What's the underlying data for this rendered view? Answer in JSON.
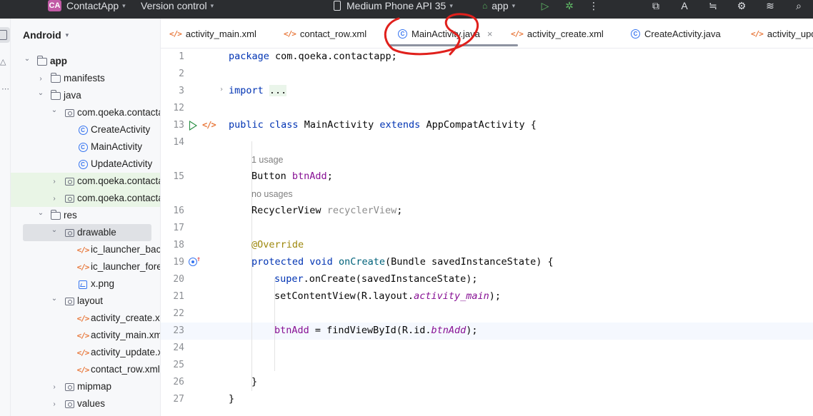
{
  "titlebar": {
    "app_badge": "CA",
    "project_name": "ContactApp",
    "vcs": "Version control",
    "device": "Medium Phone API 35",
    "run_config": "app"
  },
  "project_panel": {
    "header": "Android",
    "tree": [
      {
        "label": "app",
        "indent": 0,
        "icon": "module-folder",
        "arrow": "down",
        "bold": true
      },
      {
        "label": "manifests",
        "indent": 1,
        "icon": "folder",
        "arrow": "right"
      },
      {
        "label": "java",
        "indent": 1,
        "icon": "folder",
        "arrow": "down"
      },
      {
        "label": "com.qoeka.contactapp",
        "indent": 2,
        "icon": "package",
        "arrow": "down"
      },
      {
        "label": "CreateActivity",
        "indent": 3,
        "icon": "class"
      },
      {
        "label": "MainActivity",
        "indent": 3,
        "icon": "class"
      },
      {
        "label": "UpdateActivity",
        "indent": 3,
        "icon": "class"
      },
      {
        "label": "com.qoeka.contactapp (androidTest)",
        "indent": 2,
        "icon": "package",
        "arrow": "right",
        "green": true
      },
      {
        "label": "com.qoeka.contactapp (test)",
        "indent": 2,
        "icon": "package",
        "arrow": "right",
        "green": true
      },
      {
        "label": "res",
        "indent": 1,
        "icon": "folder",
        "arrow": "down"
      },
      {
        "label": "drawable",
        "indent": 2,
        "icon": "package",
        "arrow": "down",
        "selected": true
      },
      {
        "label": "ic_launcher_background.xml",
        "indent": 3,
        "icon": "xml"
      },
      {
        "label": "ic_launcher_foreground.xml",
        "indent": 3,
        "icon": "xml"
      },
      {
        "label": "x.png",
        "indent": 3,
        "icon": "image"
      },
      {
        "label": "layout",
        "indent": 2,
        "icon": "package",
        "arrow": "down"
      },
      {
        "label": "activity_create.xml",
        "indent": 3,
        "icon": "xml"
      },
      {
        "label": "activity_main.xml",
        "indent": 3,
        "icon": "xml"
      },
      {
        "label": "activity_update.xml",
        "indent": 3,
        "icon": "xml"
      },
      {
        "label": "contact_row.xml",
        "indent": 3,
        "icon": "xml"
      },
      {
        "label": "mipmap",
        "indent": 2,
        "icon": "package",
        "arrow": "right"
      },
      {
        "label": "values",
        "indent": 2,
        "icon": "package",
        "arrow": "right"
      }
    ]
  },
  "tabs": [
    {
      "label": "activity_main.xml",
      "icon": "xml"
    },
    {
      "label": "contact_row.xml",
      "icon": "xml"
    },
    {
      "label": "MainActivity.java",
      "icon": "class",
      "active": true,
      "close": "×"
    },
    {
      "label": "activity_create.xml",
      "icon": "xml"
    },
    {
      "label": "CreateActivity.java",
      "icon": "class"
    },
    {
      "label": "activity_update.xml",
      "icon": "xml"
    }
  ],
  "editor": {
    "line_numbers": [
      "1",
      "2",
      "3",
      "12",
      "13",
      "14",
      "15",
      "16",
      "17",
      "18",
      "19",
      "20",
      "21",
      "22",
      "23",
      "24",
      "25",
      "26",
      "27"
    ],
    "hint_usage_1": "1 usage",
    "hint_usage_2": "no usages",
    "code": {
      "l1_kw": "package",
      "l1_rest": " com.qoeka.contactapp;",
      "l3_kw": "import",
      "l3_fold": "...",
      "l13_kw1": "public",
      "l13_kw2": "class",
      "l13_name": "MainActivity",
      "l13_kw3": "extends",
      "l13_rest": "AppCompatActivity {",
      "l15_type": "Button",
      "l15_field": "btnAdd",
      "l15_end": ";",
      "l16_type": "RecyclerView",
      "l16_field": "recyclerView",
      "l16_end": ";",
      "l18_ann": "@Override",
      "l19_kw1": "protected",
      "l19_kw2": "void",
      "l19_method": "onCreate",
      "l19_rest": "(Bundle savedInstanceState) {",
      "l20_kw": "super",
      "l20_rest": ".onCreate(savedInstanceState);",
      "l21_pre": "setContentView(R.layout.",
      "l21_ital": "activity_main",
      "l21_post": ");",
      "l23_field": "btnAdd",
      "l23_mid": " = findViewById(R.id.",
      "l23_ital": "btnAdd",
      "l23_post": ");",
      "l26": "}",
      "l27": "}"
    }
  },
  "colors": {
    "titlebar_bg": "#2b2d30",
    "keyword": "#0033b3",
    "field": "#871094",
    "annotation": "#9e880d",
    "annotation_circle": "#e0201c"
  }
}
